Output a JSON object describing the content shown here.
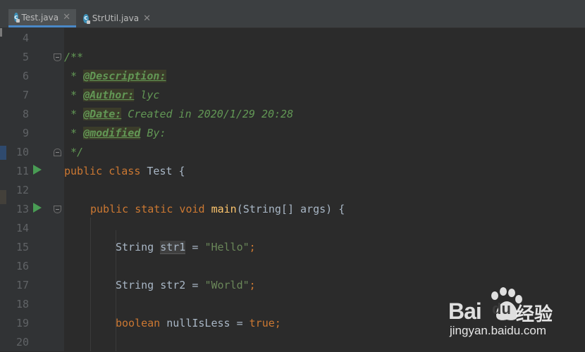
{
  "tabs": [
    {
      "label": "Test.java",
      "icon": "java-class-icon",
      "active": true
    },
    {
      "label": "StrUtil.java",
      "icon": "java-class-icon",
      "active": false
    }
  ],
  "line_numbers": [
    "4",
    "5",
    "6",
    "7",
    "8",
    "9",
    "10",
    "11",
    "12",
    "13",
    "14",
    "15",
    "16",
    "17",
    "18",
    "19",
    "20"
  ],
  "code": {
    "l5_open": "/**",
    "l6_star": " * ",
    "l6_tag": "@Description:",
    "l7_star": " * ",
    "l7_tag": "@Author:",
    "l7_text": " lyc",
    "l8_star": " * ",
    "l8_tag": "@Date:",
    "l8_text": " Created in 2020/1/29 20:28",
    "l9_star": " * ",
    "l9_tag": "@modified",
    "l9_text": " By:",
    "l10_close": " */",
    "l11_kw": "public class",
    "l11_name": " Test {",
    "l13_kw": "public static void",
    "l13_fn": "main",
    "l13_rest": "(String[] args) {",
    "l15_type": "String ",
    "l15_var": "str1",
    "l15_eq": " = ",
    "l15_str": "\"Hello\"",
    "l15_semi": ";",
    "l17_type": "String str2 = ",
    "l17_str": "\"World\"",
    "l17_semi": ";",
    "l19_kw": "boolean",
    "l19_mid": " nullIsLess = ",
    "l19_val": "true",
    "l19_semi": ";"
  },
  "watermark": {
    "bai": "Bai",
    "du": "du",
    "cn": "经验",
    "url": "jingyan.baidu.com"
  },
  "colors": {
    "background": "#2b2b2b",
    "gutter": "#313335",
    "keyword": "#cc7832",
    "comment": "#629755",
    "string": "#6a8759",
    "method": "#ffc66d",
    "run_icon": "#499c54",
    "tab_accent": "#4a88c7"
  }
}
